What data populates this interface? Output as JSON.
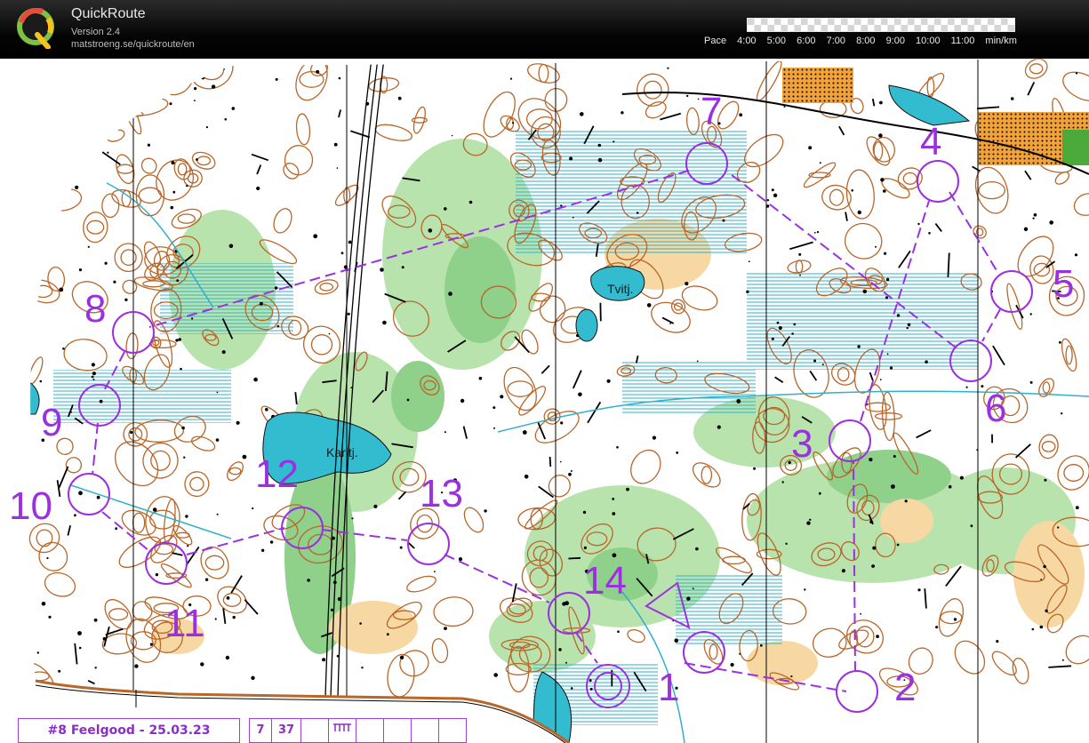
{
  "app": {
    "title": "QuickRoute",
    "version": "Version 2.4",
    "url": "matstroeng.se/quickroute/en",
    "logo_letter": "Q"
  },
  "pace_scale": {
    "label": "Pace",
    "ticks": [
      "4:00",
      "5:00",
      "6:00",
      "7:00",
      "8:00",
      "9:00",
      "10:00",
      "11:00"
    ],
    "unit": "min/km"
  },
  "map": {
    "lakes": [
      {
        "name": "Tvitj."
      },
      {
        "name": "Karitj."
      }
    ],
    "controls": [
      {
        "num": "1"
      },
      {
        "num": "2"
      },
      {
        "num": "3"
      },
      {
        "num": "4"
      },
      {
        "num": "5"
      },
      {
        "num": "6"
      },
      {
        "num": "7"
      },
      {
        "num": "8"
      },
      {
        "num": "9"
      },
      {
        "num": "10"
      },
      {
        "num": "11"
      },
      {
        "num": "12"
      },
      {
        "num": "13"
      },
      {
        "num": "14"
      }
    ],
    "colors": {
      "course": "#9b30e0",
      "forest": "#ffffff",
      "green": "#8fd08a",
      "light_green": "#c9ebbf",
      "open_land": "#f6d49a",
      "contour": "#b05a1e",
      "water": "#33bcd0",
      "marsh": "#37a9c4",
      "rock": "#000000",
      "yellow": "#f0a530"
    }
  },
  "info_bar": {
    "event": "#8 Feelgood - 25.03.23",
    "cells": [
      "7",
      "37",
      "",
      "",
      "",
      "",
      ""
    ]
  }
}
